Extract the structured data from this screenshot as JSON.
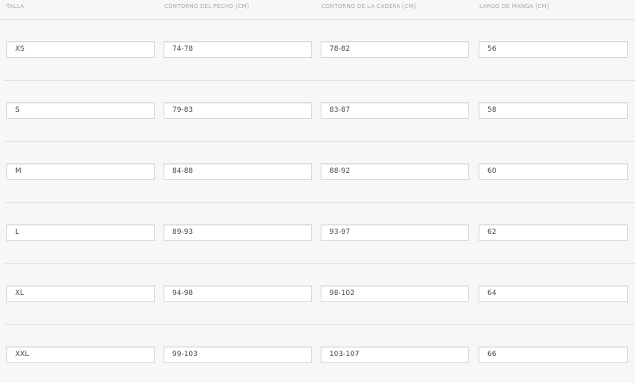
{
  "table": {
    "headers": [
      "TALLA",
      "CONTORNO DEL PECHO [CM]",
      "CONTORNO DE LA CADERA [CM]",
      "LARGO DE MANGA [CM]"
    ],
    "rows": [
      [
        "XS",
        "74-78",
        "78-82",
        "56"
      ],
      [
        "S",
        "79-83",
        "83-87",
        "58"
      ],
      [
        "M",
        "84-88",
        "88-92",
        "60"
      ],
      [
        "L",
        "89-93",
        "93-97",
        "62"
      ],
      [
        "XL",
        "94-98",
        "98-102",
        "64"
      ],
      [
        "XXL",
        "99-103",
        "103-107",
        "66"
      ]
    ]
  }
}
